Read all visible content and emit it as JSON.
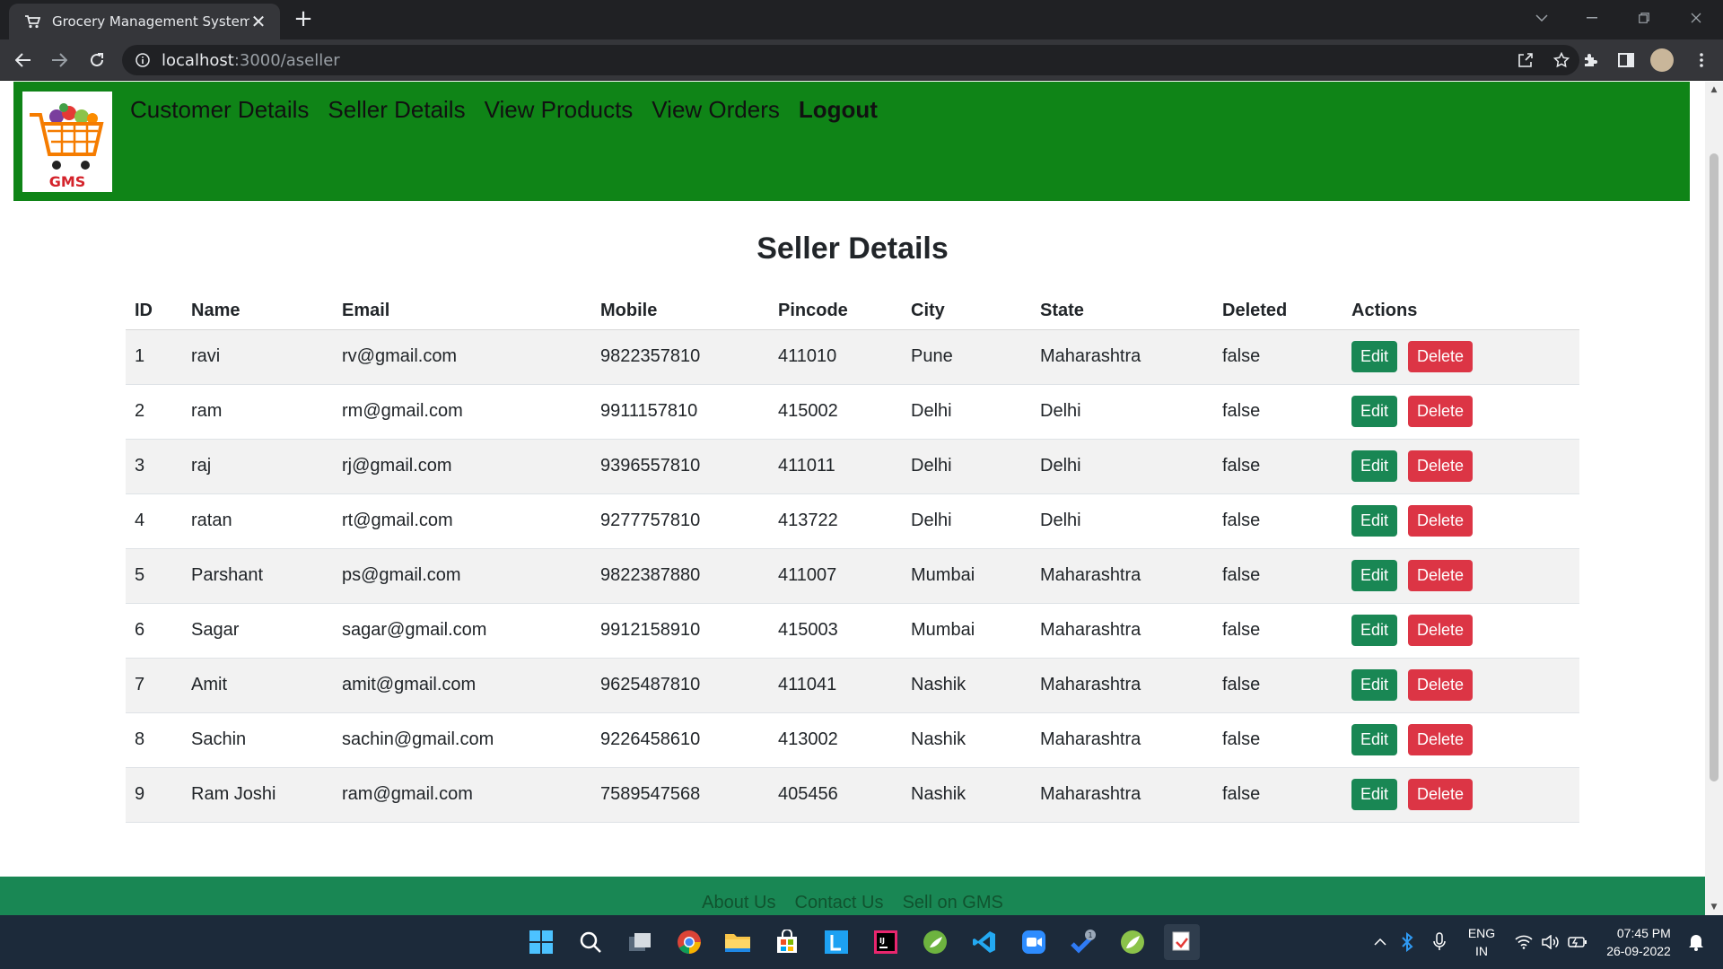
{
  "browser": {
    "tab_title": "Grocery Management System",
    "tab_close": "✕",
    "new_tab": "+",
    "url_host": "localhost",
    "url_path": ":3000/aseller"
  },
  "navbar": {
    "logo_text": "GMS",
    "links": [
      "Customer Details",
      "Seller Details",
      "View Products",
      "View Orders"
    ],
    "logout": "Logout"
  },
  "page": {
    "title": "Seller Details"
  },
  "table": {
    "headers": [
      "ID",
      "Name",
      "Email",
      "Mobile",
      "Pincode",
      "City",
      "State",
      "Deleted",
      "Actions"
    ],
    "rows": [
      {
        "id": "1",
        "name": "ravi",
        "email": "rv@gmail.com",
        "mobile": "9822357810",
        "pincode": "411010",
        "city": "Pune",
        "state": "Maharashtra",
        "deleted": "false"
      },
      {
        "id": "2",
        "name": "ram",
        "email": "rm@gmail.com",
        "mobile": "9911157810",
        "pincode": "415002",
        "city": "Delhi",
        "state": "Delhi",
        "deleted": "false"
      },
      {
        "id": "3",
        "name": "raj",
        "email": "rj@gmail.com",
        "mobile": "9396557810",
        "pincode": "411011",
        "city": "Delhi",
        "state": "Delhi",
        "deleted": "false"
      },
      {
        "id": "4",
        "name": "ratan",
        "email": "rt@gmail.com",
        "mobile": "9277757810",
        "pincode": "413722",
        "city": "Delhi",
        "state": "Delhi",
        "deleted": "false"
      },
      {
        "id": "5",
        "name": "Parshant",
        "email": "ps@gmail.com",
        "mobile": "9822387880",
        "pincode": "411007",
        "city": "Mumbai",
        "state": "Maharashtra",
        "deleted": "false"
      },
      {
        "id": "6",
        "name": "Sagar",
        "email": "sagar@gmail.com",
        "mobile": "9912158910",
        "pincode": "415003",
        "city": "Mumbai",
        "state": "Maharashtra",
        "deleted": "false"
      },
      {
        "id": "7",
        "name": "Amit",
        "email": "amit@gmail.com",
        "mobile": "9625487810",
        "pincode": "411041",
        "city": "Nashik",
        "state": "Maharashtra",
        "deleted": "false"
      },
      {
        "id": "8",
        "name": "Sachin",
        "email": "sachin@gmail.com",
        "mobile": "9226458610",
        "pincode": "413002",
        "city": "Nashik",
        "state": "Maharashtra",
        "deleted": "false"
      },
      {
        "id": "9",
        "name": "Ram Joshi",
        "email": "ram@gmail.com",
        "mobile": "7589547568",
        "pincode": "405456",
        "city": "Nashik",
        "state": "Maharashtra",
        "deleted": "false"
      }
    ],
    "edit_label": "Edit",
    "delete_label": "Delete"
  },
  "footer": {
    "links": [
      "About Us",
      "Contact Us",
      "Sell on GMS"
    ]
  },
  "taskbar": {
    "apps": [
      "windows-start-icon",
      "search-icon",
      "task-view-icon",
      "chrome-icon",
      "file-explorer-icon",
      "microsoft-store-icon",
      "lens-app-icon",
      "intellij-icon",
      "spring-tool-icon",
      "vscode-icon",
      "zoom-icon",
      "todo-icon",
      "spring-boot-icon",
      "snipping-tool-icon"
    ],
    "todo_badge": "1",
    "lang_line1": "ENG",
    "lang_line2": "IN",
    "time": "07:45 PM",
    "date": "26-09-2022"
  },
  "colors": {
    "navbar_bg": "#0f8417",
    "footer_bg": "#198754",
    "edit_btn": "#198754",
    "delete_btn": "#dc3545",
    "logo_text": "#d4232b"
  }
}
